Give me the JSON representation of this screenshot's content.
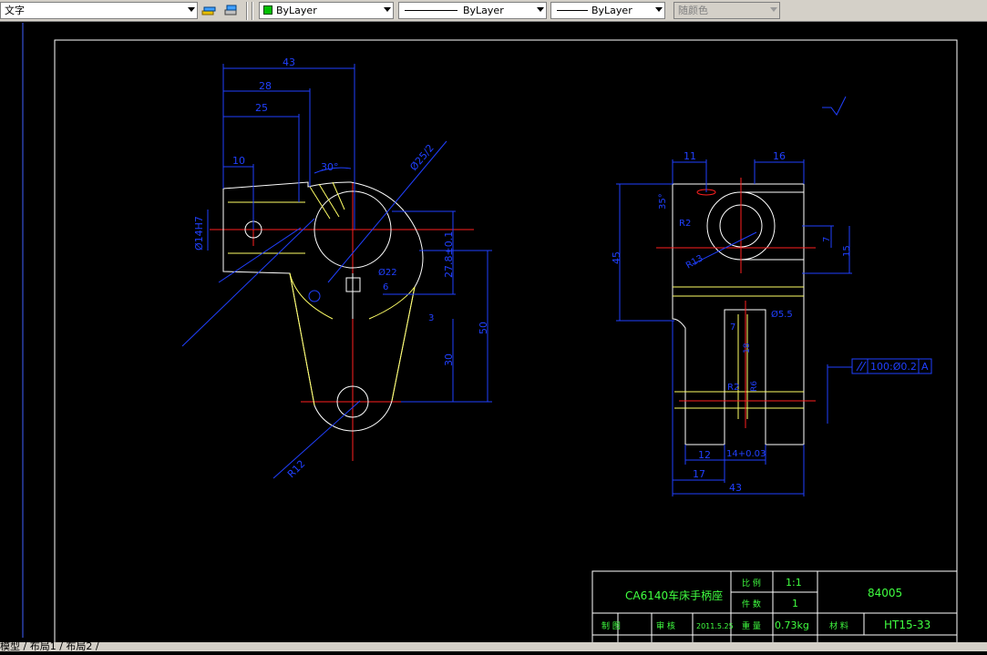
{
  "toolbar": {
    "text_style": "文字",
    "color": "ByLayer",
    "linetype": "ByLayer",
    "lineweight": "ByLayer",
    "plot_style": "随颜色"
  },
  "drawing": {
    "left_view": {
      "dim_43": "43",
      "dim_28": "28",
      "dim_25": "25",
      "dim_10": "10",
      "dim_30deg": "30°",
      "dim_phi14h7": "Ø14H7",
      "dim_phi25_2": "Ø25/2",
      "dim_27": "27.8±0.1",
      "dim_50": "50",
      "dim_30": "30",
      "dim_r12": "R12",
      "dim_phi22": "Ø22",
      "dim_6": "6",
      "dim_3": "3"
    },
    "right_view": {
      "dim_11": "11",
      "dim_16": "16",
      "dim_35": "35°",
      "dim_r2": "R2",
      "dim_r13": "R13",
      "dim_45": "45",
      "dim_7": "7",
      "dim_15": "15",
      "dim_phi55": "Ø5.5",
      "dim_7b": "7",
      "dim_18": "18",
      "dim_r2b": "R2",
      "dim_r6": "R6",
      "dim_12": "12",
      "dim_14": "14+0.03",
      "dim_17": "17",
      "dim_43": "43",
      "tolerance": "100:Ø0.2",
      "datum": "A"
    },
    "title_block": {
      "part_name": "CA6140车床手柄座",
      "scale_label": "比 例",
      "scale": "1:1",
      "qty_label": "件 数",
      "qty": "1",
      "drawing_no": "84005",
      "design_label": "制 图",
      "check_label": "审 核",
      "date": "2011.5.25",
      "weight_label": "重 量",
      "weight": "0.73kg",
      "material_label": "材 料",
      "material": "HT15-33"
    }
  },
  "tabs": {
    "label": "模型 / 布局1 / 布局2 /"
  }
}
